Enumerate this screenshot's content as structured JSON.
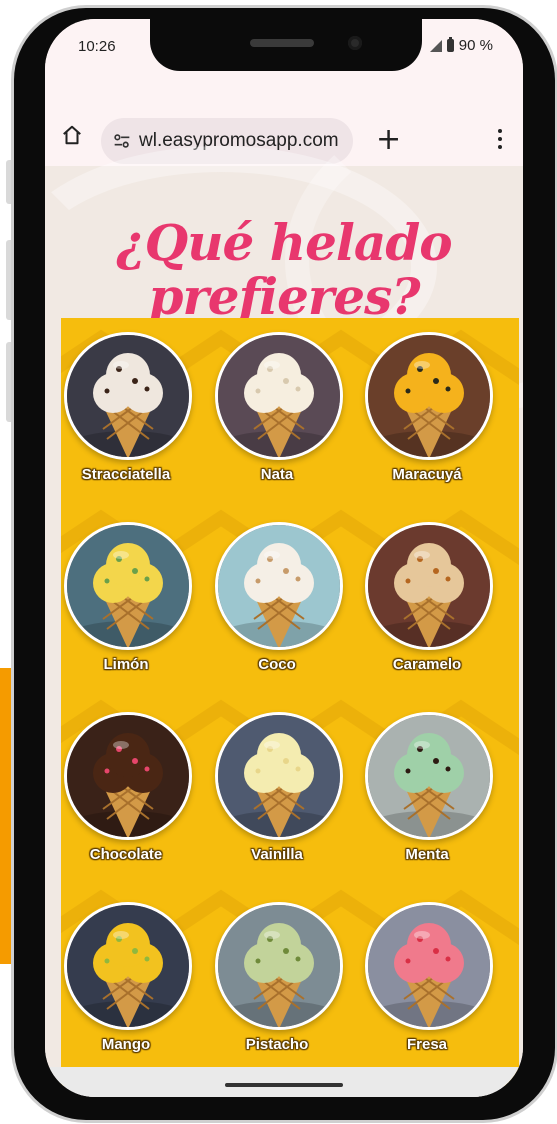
{
  "status": {
    "time": "10:26",
    "battery": "90 %"
  },
  "browser": {
    "url": "wl.easypromosapp.com"
  },
  "page": {
    "title_line1": "¿Qué helado",
    "title_line2": "prefieres?"
  },
  "flavors": [
    {
      "label": "Stracciatella",
      "scoop_color": "#efe7de",
      "accent": "#3b2418",
      "bg": "#3a3a46"
    },
    {
      "label": "Nata",
      "scoop_color": "#f6eedf",
      "accent": "#d8c9ae",
      "bg": "#5a4a55"
    },
    {
      "label": "Maracuyá",
      "scoop_color": "#f5b21c",
      "accent": "#2a2a1a",
      "bg": "#6a3f2a"
    },
    {
      "label": "Limón",
      "scoop_color": "#f3d64b",
      "accent": "#6aa04a",
      "bg": "#4d6f7e"
    },
    {
      "label": "Coco",
      "scoop_color": "#f5efe6",
      "accent": "#c79b6a",
      "bg": "#9cc6cf"
    },
    {
      "label": "Caramelo",
      "scoop_color": "#e6c79a",
      "accent": "#b5661f",
      "bg": "#6b3a2e"
    },
    {
      "label": "Chocolate",
      "scoop_color": "#4a2614",
      "accent": "#e6466b",
      "bg": "#3a2218"
    },
    {
      "label": "Vainilla",
      "scoop_color": "#f4ecb0",
      "accent": "#e8d68a",
      "bg": "#4f5a70"
    },
    {
      "label": "Menta",
      "scoop_color": "#9fd0a8",
      "accent": "#2d1a12",
      "bg": "#aab2b0"
    },
    {
      "label": "Mango",
      "scoop_color": "#f2c21f",
      "accent": "#8fb83e",
      "bg": "#353c4e"
    },
    {
      "label": "Pistacho",
      "scoop_color": "#c2d39a",
      "accent": "#6f8a3a",
      "bg": "#7d8c94"
    },
    {
      "label": "Fresa",
      "scoop_color": "#f07a8c",
      "accent": "#d92f45",
      "bg": "#8a8fa0"
    }
  ],
  "colors": {
    "title": "#e8376e",
    "panel": "#f6bd0d",
    "accent_left": "#f59b00",
    "cone": "#d39a47"
  },
  "icons": {
    "home": "home-icon",
    "site_settings": "tune-icon",
    "new_tab": "plus-icon",
    "menu": "more-vert-icon"
  }
}
